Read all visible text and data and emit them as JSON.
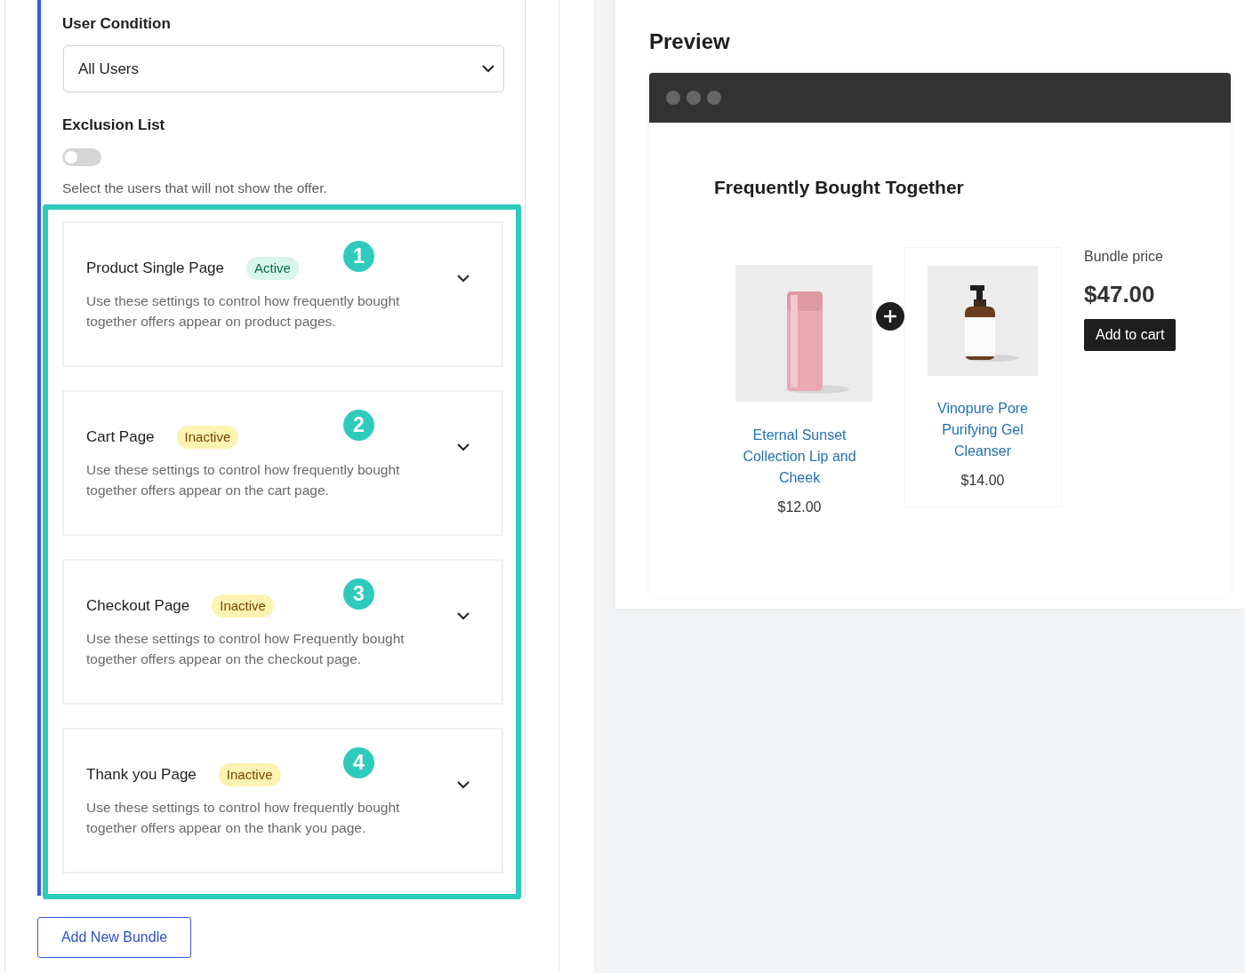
{
  "user_condition": {
    "label": "User Condition",
    "value": "All Users"
  },
  "exclusion_list": {
    "label": "Exclusion List",
    "on": false,
    "help": "Select the users that will not show the offer."
  },
  "placements": [
    {
      "title": "Product Single Page",
      "status": "Active",
      "active": true,
      "marker": "1",
      "description": "Use these settings to control how frequently bought together offers appear on product pages."
    },
    {
      "title": "Cart Page",
      "status": "Inactive",
      "active": false,
      "marker": "2",
      "description": "Use these settings to control how frequently bought together offers appear on the cart page."
    },
    {
      "title": "Checkout Page",
      "status": "Inactive",
      "active": false,
      "marker": "3",
      "description": "Use these settings to control how Frequently bought together offers appear on the checkout page."
    },
    {
      "title": "Thank you Page",
      "status": "Inactive",
      "active": false,
      "marker": "4",
      "description": "Use these settings to control how frequently bought together offers appear on the thank you page."
    }
  ],
  "add_button": "Add New Bundle",
  "preview": {
    "title": "Preview",
    "heading": "Frequently Bought Together",
    "products": [
      {
        "name": "Eternal Sunset Collection Lip and Cheek",
        "price": "$12.00"
      },
      {
        "name": "Vinopure Pore Purifying Gel Cleanser",
        "price": "$14.00"
      }
    ],
    "bundle_label": "Bundle price",
    "bundle_price": "$47.00",
    "cart_button": "Add to cart"
  }
}
